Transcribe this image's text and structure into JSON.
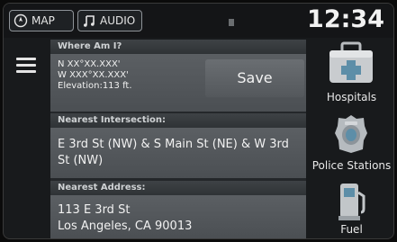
{
  "topbar": {
    "map_label": "MAP",
    "audio_label": "AUDIO",
    "clock": "12:34"
  },
  "where_am_i": {
    "header": "Where Am I?",
    "lat": "N XX°XX.XXX'",
    "lon": "W XXX°XX.XXX'",
    "elevation": "Elevation:113 ft.",
    "save_label": "Save"
  },
  "nearest_intersection": {
    "header": "Nearest Intersection:",
    "text": "E 3rd St (NW) & S Main St (NE) & W 3rd St (NW)"
  },
  "nearest_address": {
    "header": "Nearest Address:",
    "line1": "113 E 3rd St",
    "line2": "Los Angeles, CA 90013"
  },
  "poi": [
    {
      "label": "Hospitals",
      "icon": "first-aid-kit-icon"
    },
    {
      "label": "Police Stations",
      "icon": "police-badge-icon"
    },
    {
      "label": "Fuel",
      "icon": "fuel-pump-icon"
    }
  ]
}
